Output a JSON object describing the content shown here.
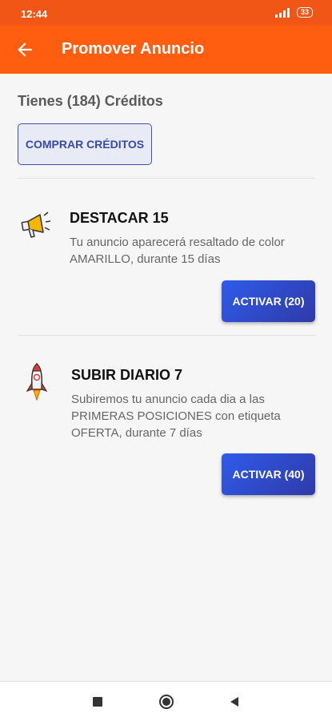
{
  "status_bar": {
    "time": "12:44",
    "battery": "33"
  },
  "app_bar": {
    "title": "Promover Anuncio"
  },
  "credits": {
    "text": "Tienes (184) Créditos",
    "buy_label": "COMPRAR CRÉDITOS"
  },
  "promotions": [
    {
      "title": "DESTACAR 15",
      "description": "Tu anuncio aparecerá resaltado de color AMARILLO, durante 15 días",
      "button_label": "ACTIVAR (20)",
      "icon": "megaphone-icon"
    },
    {
      "title": "SUBIR DIARIO 7",
      "description": "Subiremos tu anuncio cada dia a las PRIMERAS POSICIONES con etiqueta OFERTA, durante 7 días",
      "button_label": "ACTIVAR (40)",
      "icon": "rocket-icon"
    }
  ],
  "colors": {
    "status_bar": "#f25617",
    "app_bar": "#ff5e10",
    "button_blue": "#2f5bea",
    "buy_border": "#3f51b5"
  }
}
